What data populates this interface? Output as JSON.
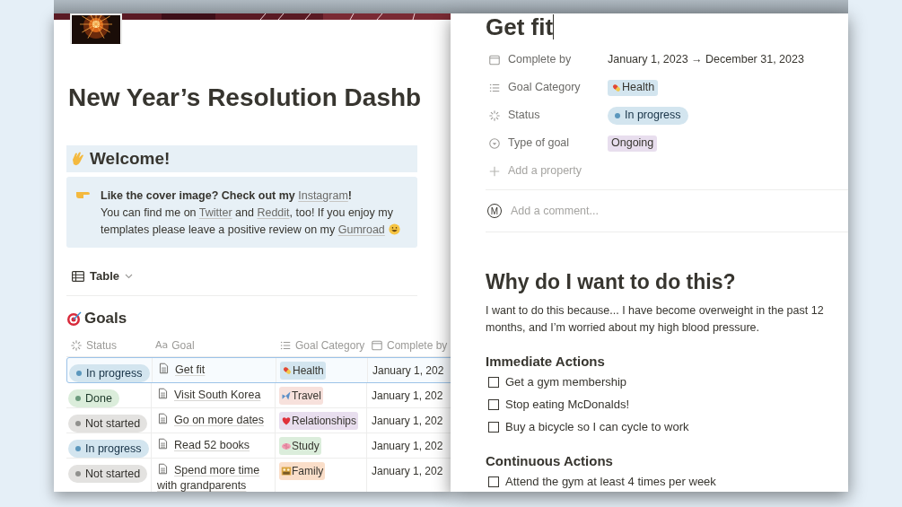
{
  "page": {
    "title": "New Year’s Resolution Dashb",
    "welcome": {
      "heading": "Welcome!",
      "lines": [
        [
          {
            "text": "Like the cover image? Check out my ",
            "link": false
          },
          {
            "text": "Instagram",
            "link": true
          },
          {
            "text": "!",
            "link": false
          }
        ],
        [
          {
            "text": "You can find me on ",
            "link": false
          },
          {
            "text": "Twitter",
            "link": true
          },
          {
            "text": " and ",
            "link": false
          },
          {
            "text": "Reddit",
            "link": true
          },
          {
            "text": ", too! If you enjoy my templates please leave a positive review on my ",
            "link": false
          },
          {
            "text": "Gumroad",
            "link": true
          }
        ]
      ]
    },
    "view": {
      "label": "Table"
    },
    "database": {
      "title": "Goals",
      "columns": [
        {
          "label": "Status",
          "kind": "status"
        },
        {
          "label": "Goal",
          "kind": "title",
          "prefix": "Aa"
        },
        {
          "label": "Goal Category",
          "kind": "multi"
        },
        {
          "label": "Complete by",
          "kind": "date"
        }
      ],
      "rows": [
        {
          "selected": true,
          "status": {
            "label": "In progress",
            "kind": "in_progress"
          },
          "goal": "Get fit",
          "category": {
            "label": "Health",
            "color": "#d3e5ef"
          },
          "date": "January 1, 202"
        },
        {
          "selected": false,
          "status": {
            "label": "Done",
            "kind": "done"
          },
          "goal": "Visit South Korea",
          "category": {
            "label": "Travel",
            "color": "#f7e1dc"
          },
          "date": "January 1, 202"
        },
        {
          "selected": false,
          "status": {
            "label": "Not started",
            "kind": "not_started"
          },
          "goal": "Go on more dates",
          "category": {
            "label": "Relationships",
            "color": "#e8deee"
          },
          "date": "January 1, 202"
        },
        {
          "selected": false,
          "status": {
            "label": "In progress",
            "kind": "in_progress"
          },
          "goal": "Read 52 books",
          "category": {
            "label": "Study",
            "color": "#dbeddb"
          },
          "date": "January 1, 202"
        },
        {
          "selected": false,
          "status": {
            "label": "Not started",
            "kind": "not_started"
          },
          "goal": "Spend more time with grandparents",
          "category": {
            "label": "Family",
            "color": "#fadec9"
          },
          "date": "January 1, 202"
        }
      ]
    }
  },
  "detail": {
    "title": "Get fit",
    "properties": [
      {
        "label": "Complete by",
        "kind": "date",
        "value": "January 1, 2023 → December 31, 2023"
      },
      {
        "label": "Goal Category",
        "kind": "multi",
        "value": "Health",
        "color": "#d3e5ef"
      },
      {
        "label": "Status",
        "kind": "status",
        "status": {
          "label": "In progress",
          "kind": "in_progress"
        }
      },
      {
        "label": "Type of goal",
        "kind": "select",
        "value": "Ongoing",
        "color": "#e8deee"
      }
    ],
    "add_property": "Add a property",
    "comment": {
      "avatar": "M",
      "placeholder": "Add a comment..."
    },
    "heading": "Why do I want to do this?",
    "paragraph": "I want to do this because... I have become overweight in the past 12 months, and I’m worried about my high blood pressure.",
    "sections": [
      {
        "title": "Immediate Actions",
        "items": [
          {
            "text": "Get a gym membership",
            "checked": false
          },
          {
            "text": "Stop eating McDonalds!",
            "checked": false
          },
          {
            "text": "Buy a bicycle so I can cycle to work",
            "checked": false
          }
        ]
      },
      {
        "title": "Continuous Actions",
        "items": [
          {
            "text": "Attend the gym at least 4 times per week",
            "checked": false
          }
        ]
      }
    ]
  }
}
